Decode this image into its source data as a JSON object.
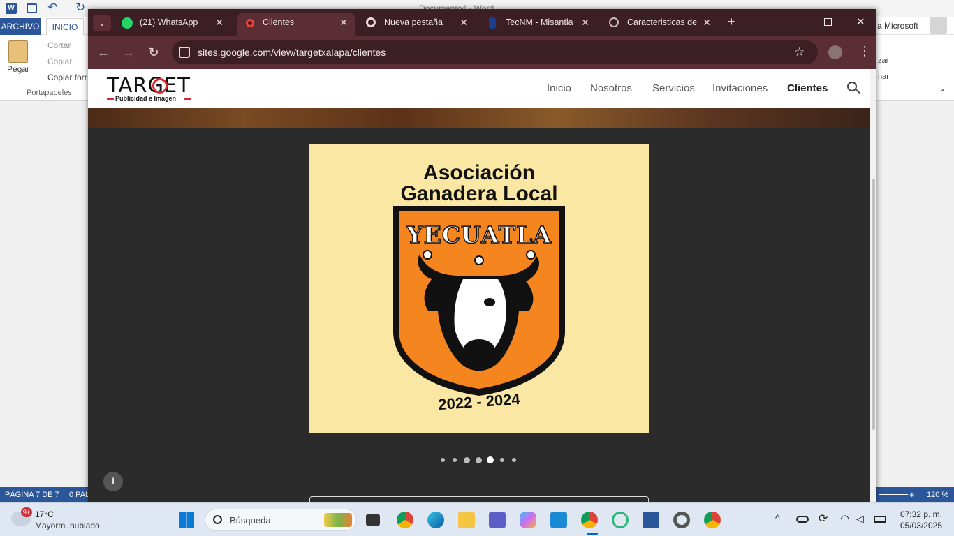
{
  "word": {
    "title": "Documento4 - Word",
    "tab_archivo": "ARCHIVO",
    "tab_inicio": "INICIO",
    "account": "a Microsoft",
    "pegar": "Pegar",
    "cortar": "Cortar",
    "copiar": "Copiar",
    "copiar_formato": "Copiar forr",
    "portapapeles": "Portapapeles",
    "right_frag_1": "zar",
    "right_frag_2": "nar",
    "status_page": "PÁGINA 7 DE 7",
    "status_words": "0 PAL",
    "zoom": "120 %"
  },
  "chrome": {
    "tabs": [
      {
        "label": "(21) WhatsApp",
        "icon": "whatsapp-icon",
        "color": "#25d366"
      },
      {
        "label": "Clientes",
        "icon": "google-sites-icon",
        "color": "#ea4335"
      },
      {
        "label": "Nueva pestaña",
        "icon": "chrome-icon",
        "color": "#e8d6d8"
      },
      {
        "label": "TecNM - Misantla",
        "icon": "tecnm-icon",
        "color": "#1b3f8b"
      },
      {
        "label": "Caracteristicas de p",
        "icon": "globe-icon",
        "color": "#c9b9bb"
      }
    ],
    "url": "sites.google.com/view/targetxalapa/clientes"
  },
  "site": {
    "logo_text": "TARGET",
    "logo_sub": "Publicidad e Imagen",
    "nav": [
      "Inicio",
      "Nosotros",
      "Servicios",
      "Invitaciones",
      "Clientes"
    ],
    "active_nav": "Clientes",
    "slide": {
      "title_line1": "Asociación",
      "title_line2": "Ganadera Local",
      "shield_text": "YECUATLA",
      "years": "2022 - 2024"
    },
    "carousel_count": 7,
    "carousel_active": 5
  },
  "taskbar": {
    "weather_temp": "17°C",
    "weather_desc": "Mayorm. nublado",
    "weather_badge": "9+",
    "search_placeholder": "Búsqueda",
    "time": "07:32 p. m.",
    "date": "05/03/2025"
  }
}
